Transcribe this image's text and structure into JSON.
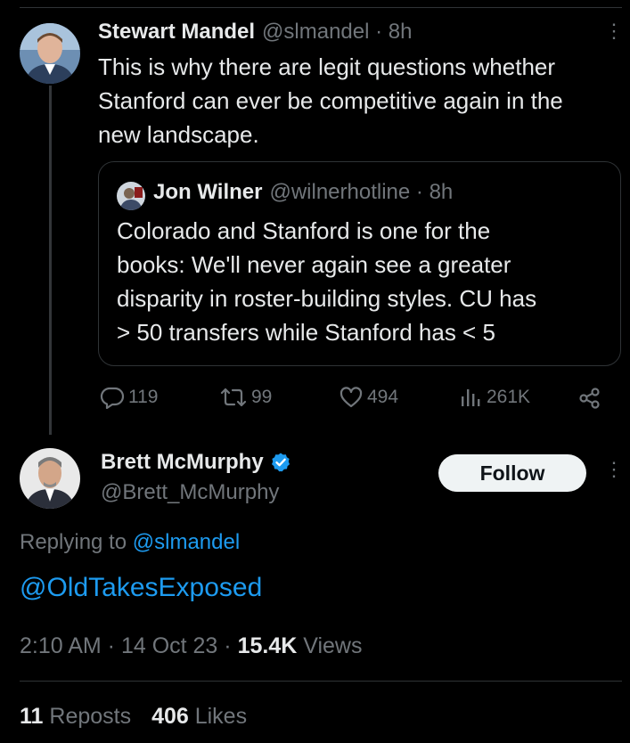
{
  "parent_tweet": {
    "author_name": "Stewart Mandel",
    "handle_time": "@slmandel · 8h",
    "text_lines": [
      "This is why there are legit questions whether",
      "Stanford can ever be competitive again in the",
      "new landscape."
    ],
    "quoted": {
      "author_name": "Jon Wilner",
      "handle_time": "@wilnerhotline · 8h",
      "text_lines": [
        "Colorado and Stanford is one for the",
        "books: We'll never again see a greater",
        "disparity in roster-building styles. CU has",
        "> 50 transfers while Stanford has < 5"
      ]
    },
    "actions": {
      "replies": "119",
      "reposts": "99",
      "likes": "494",
      "views": "261K"
    }
  },
  "main_tweet": {
    "author_name": "Brett McMurphy",
    "handle": "@Brett_McMurphy",
    "follow_label": "Follow",
    "replying_prefix": "Replying to",
    "replying_handle": "@slmandel",
    "text": "@OldTakesExposed",
    "time_date": "2:10 AM · 14 Oct 23 · ",
    "views_count": "15.4K",
    "views_label": " Views",
    "reposts_count": "11",
    "reposts_label": " Reposts",
    "likes_count": "406",
    "likes_label": " Likes"
  },
  "colors": {
    "background": "#000000",
    "text": "#e7e9ea",
    "muted": "#71767b",
    "link": "#1d9bf0",
    "verified": "#1d9bf0",
    "divider": "#2f3336"
  }
}
